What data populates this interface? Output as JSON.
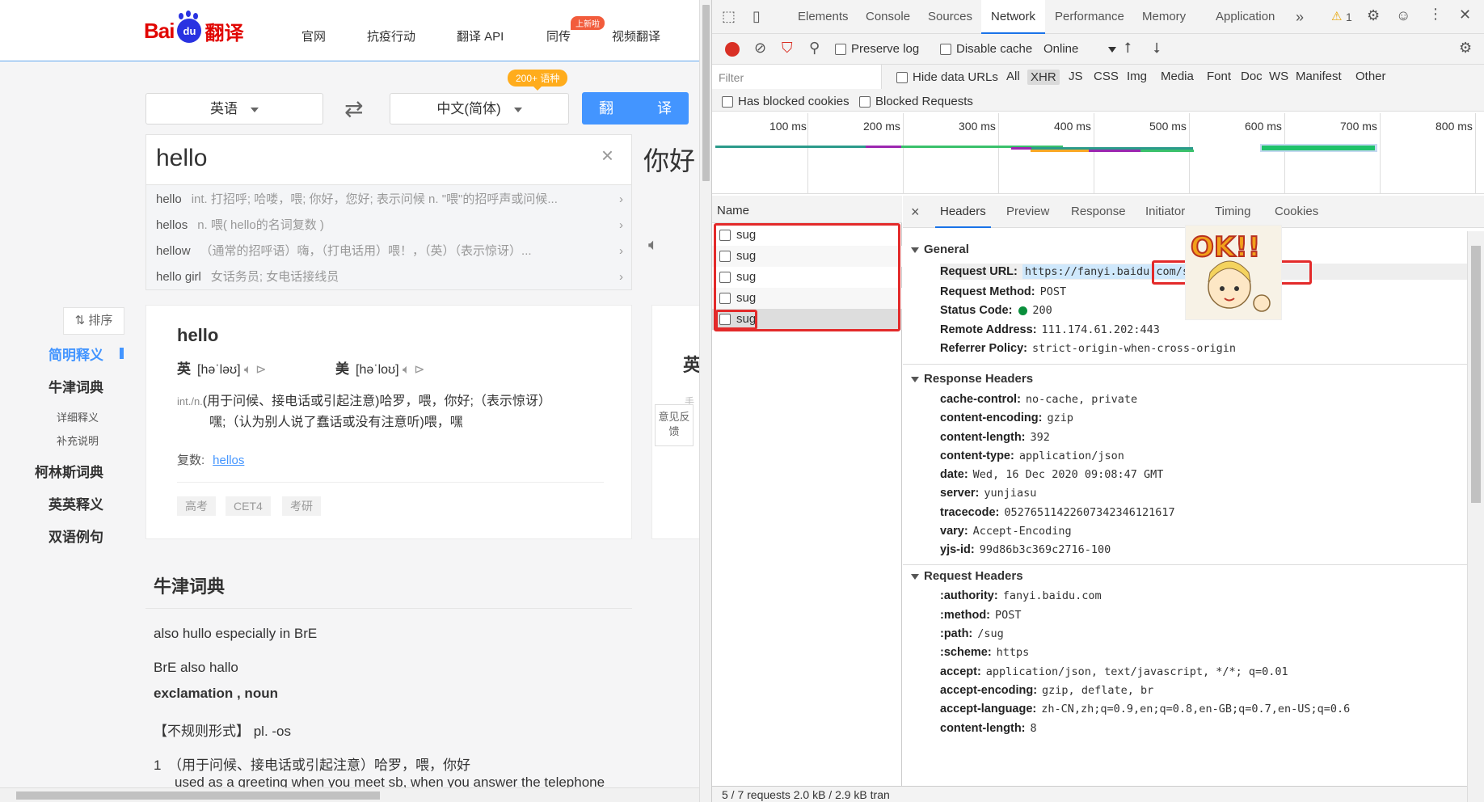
{
  "left_page": {
    "logo": {
      "text_bai": "Bai",
      "text_du": "du",
      "text_fanyi": "翻译"
    },
    "nav": [
      "官网",
      "抗疫行动",
      "翻译 API",
      "同传",
      "视频翻译"
    ],
    "nav_badge": "上新啦",
    "source_lang": "英语",
    "target_lang": "中文(简体)",
    "lang_count_badge": "200+ 语种",
    "translate_button": "翻　译",
    "input_text": "hello",
    "clear_icon": "×",
    "suggestions": [
      {
        "word": "hello",
        "def": "int. 打招呼; 哈喽，喂; 你好，您好; 表示问候 n. \"喂\"的招呼声或问候..."
      },
      {
        "word": "hellos",
        "def": "n. 喂( hello的名词复数 )"
      },
      {
        "word": "hellow",
        "def": "（通常的招呼语）嗨，（打电话用）喂！，（英）（表示惊讶）..."
      },
      {
        "word": "hello girl",
        "def": "女话务员; 女电话接线员"
      }
    ],
    "target_text": "你好",
    "sort_label": "排序",
    "sidebar": [
      "简明释义",
      "牛津词典",
      "详细释义",
      "补充说明",
      "柯林斯词典",
      "英英释义",
      "双语例句"
    ],
    "card": {
      "word": "hello",
      "uk_label": "英",
      "uk_phonetic": "[həˈləʊ]",
      "us_label": "美",
      "us_phonetic": "[həˈloʊ]",
      "pos": "int./n.",
      "def_line1": "(用于问候、接电话或引起注意)哈罗，喂，你好;（表示惊讶）",
      "def_line2": "嘿;（认为别人说了蠢话或没有注意听)喂，嘿",
      "plural_label": "复数:",
      "plural_value": "hellos",
      "tags": [
        "高考",
        "CET4",
        "考研"
      ]
    },
    "card2_char": "英",
    "card2_sub": "手",
    "feedback": "意见反馈",
    "oxford_title": "牛津词典",
    "oxford_lines": [
      "also hullo especially in BrE",
      "BrE also hallo",
      "exclamation , noun",
      "【不规则形式】 pl. -os",
      "1　（用于问候、接电话或引起注意）哈罗，喂，你好",
      "used as a greeting when you meet sb, when you answer the telephone"
    ]
  },
  "devtools": {
    "tabs": [
      "Elements",
      "Console",
      "Sources",
      "Network",
      "Performance",
      "Memory",
      "Application"
    ],
    "active_tab": "Network",
    "more_tabs": "»",
    "warning_count": "1",
    "toolbar": {
      "preserve_log": "Preserve log",
      "disable_cache": "Disable cache",
      "throttle": "Online"
    },
    "filter_placeholder": "Filter",
    "hide_data_urls": "Hide data URLs",
    "filter_types": [
      "All",
      "XHR",
      "JS",
      "CSS",
      "Img",
      "Media",
      "Font",
      "Doc",
      "WS",
      "Manifest",
      "Other"
    ],
    "active_filter": "XHR",
    "has_blocked_cookies": "Has blocked cookies",
    "blocked_requests": "Blocked Requests",
    "timeline_ticks": [
      "100 ms",
      "200 ms",
      "300 ms",
      "400 ms",
      "500 ms",
      "600 ms",
      "700 ms",
      "800 ms"
    ],
    "name_header": "Name",
    "requests": [
      "sug",
      "sug",
      "sug",
      "sug",
      "sug"
    ],
    "status_bar": "5 / 7 requests  2.0 kB / 2.9 kB tran",
    "detail_tabs": [
      "Headers",
      "Preview",
      "Response",
      "Initiator",
      "Timing",
      "Cookies"
    ],
    "close_icon": "×",
    "general_title": "General",
    "general": [
      {
        "k": "Request URL:",
        "v": "https://fanyi.baidu.com/sug"
      },
      {
        "k": "Request Method:",
        "v": "POST"
      },
      {
        "k": "Status Code:",
        "v": "200"
      },
      {
        "k": "Remote Address:",
        "v": "111.174.61.202:443"
      },
      {
        "k": "Referrer Policy:",
        "v": "strict-origin-when-cross-origin"
      }
    ],
    "response_headers_title": "Response Headers",
    "response_headers": [
      {
        "k": "cache-control:",
        "v": "no-cache, private"
      },
      {
        "k": "content-encoding:",
        "v": "gzip"
      },
      {
        "k": "content-length:",
        "v": "392"
      },
      {
        "k": "content-type:",
        "v": "application/json"
      },
      {
        "k": "date:",
        "v": "Wed, 16 Dec 2020 09:08:47 GMT"
      },
      {
        "k": "server:",
        "v": "yunjiasu"
      },
      {
        "k": "tracecode:",
        "v": "05276511422607342346121617"
      },
      {
        "k": "vary:",
        "v": "Accept-Encoding"
      },
      {
        "k": "yjs-id:",
        "v": "99d86b3c369c2716-100"
      }
    ],
    "request_headers_title": "Request Headers",
    "request_headers": [
      {
        "k": ":authority:",
        "v": "fanyi.baidu.com"
      },
      {
        "k": ":method:",
        "v": "POST"
      },
      {
        "k": ":path:",
        "v": "/sug"
      },
      {
        "k": ":scheme:",
        "v": "https"
      },
      {
        "k": "accept:",
        "v": "application/json, text/javascript, */*; q=0.01"
      },
      {
        "k": "accept-encoding:",
        "v": "gzip, deflate, br"
      },
      {
        "k": "accept-language:",
        "v": "zh-CN,zh;q=0.9,en;q=0.8,en-GB;q=0.7,en-US;q=0.6"
      },
      {
        "k": "content-length:",
        "v": "8"
      }
    ],
    "ok_sticker_text": "OK!!",
    "colors": {
      "accent": "#1a73e8",
      "record": "#d93025",
      "highlight_box": "#e32a2a",
      "baidu_blue": "#4395ff"
    }
  }
}
